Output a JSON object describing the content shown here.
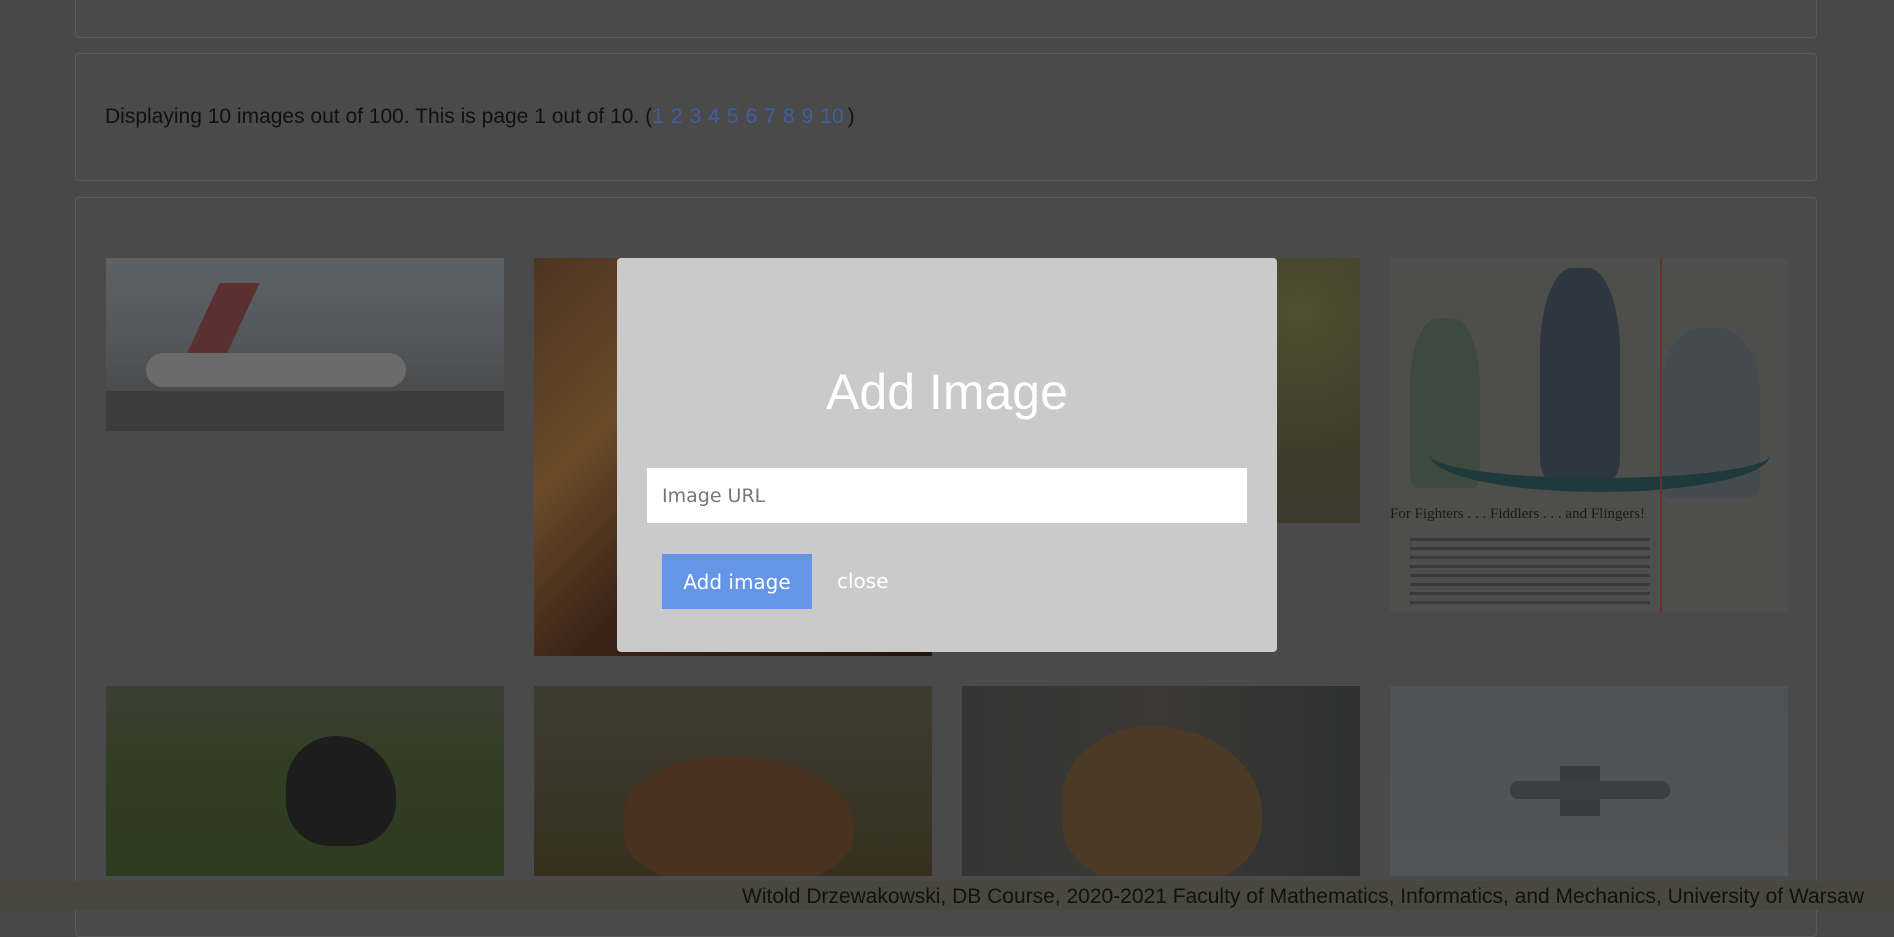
{
  "pager": {
    "text": "Displaying 10 images out of 100. This is page 1 out of 10. (",
    "pages": [
      "1",
      "2",
      "3",
      "4",
      "5",
      "6",
      "7",
      "8",
      "9",
      "10"
    ],
    "close_paren": ")"
  },
  "gallery": {
    "poster_caption": "For Fighters . . . Fiddlers . . . and Flingers!"
  },
  "modal": {
    "title": "Add Image",
    "input_placeholder": "Image URL",
    "add_button": "Add image",
    "close_button": "close"
  },
  "footer": {
    "text": "Witold Drzewakowski, DB Course, 2020-2021 Faculty of Mathematics, Informatics, and Mechanics, University of Warsaw"
  },
  "colors": {
    "overlay": "#484848",
    "modal_bg": "#cacaca",
    "primary_button": "#6595e6",
    "link": "#3f5f9f"
  }
}
